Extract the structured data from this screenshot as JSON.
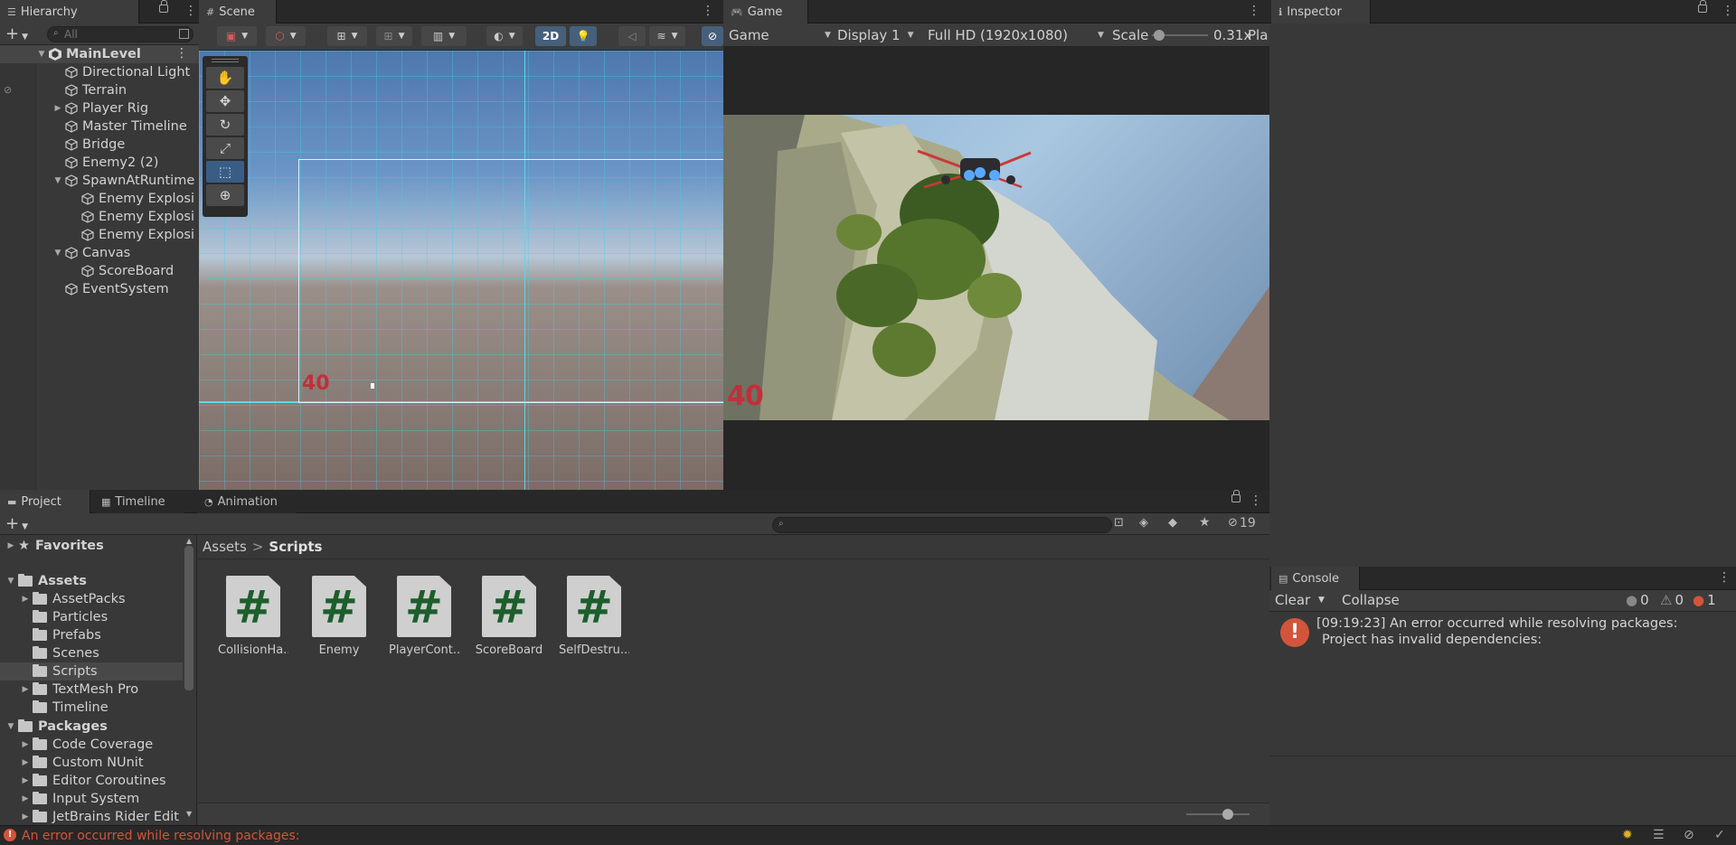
{
  "hierarchy": {
    "tab_label": "Hierarchy",
    "search_placeholder": "All",
    "scene_name": "MainLevel",
    "items": [
      {
        "label": "Directional Light"
      },
      {
        "label": "Terrain"
      },
      {
        "label": "Player Rig"
      },
      {
        "label": "Master Timeline"
      },
      {
        "label": "Bridge"
      },
      {
        "label": "Enemy2 (2)"
      },
      {
        "label": "SpawnAtRuntime"
      },
      {
        "label": "Enemy Explosi"
      },
      {
        "label": "Enemy Explosi"
      },
      {
        "label": "Enemy Explosi"
      },
      {
        "label": "Canvas"
      },
      {
        "label": "ScoreBoard"
      },
      {
        "label": "EventSystem"
      }
    ]
  },
  "scene": {
    "tab_label": "Scene",
    "toggle_2d": "2D",
    "score_text": "40"
  },
  "game": {
    "tab_label": "Game",
    "view_select": "Game",
    "display_select": "Display 1",
    "resolution_select": "Full HD (1920x1080)",
    "scale_label": "Scale",
    "scale_value": "0.31x",
    "play_cut": "Pla",
    "score_text": "40"
  },
  "inspector": {
    "tab_label": "Inspector"
  },
  "project": {
    "tabs": [
      {
        "label": "Project"
      },
      {
        "label": "Timeline"
      },
      {
        "label": "Animation"
      }
    ],
    "hidden_count": "19",
    "breadcrumb": {
      "root": "Assets",
      "sep": ">",
      "current": "Scripts"
    },
    "tree": {
      "favorites": "Favorites",
      "assets": "Assets",
      "asset_folders": [
        "AssetPacks",
        "Particles",
        "Prefabs",
        "Scenes",
        "Scripts",
        "TextMesh Pro",
        "Timeline"
      ],
      "packages": "Packages",
      "package_folders": [
        "Code Coverage",
        "Custom NUnit",
        "Editor Coroutines",
        "Input System",
        "JetBrains Rider Edit"
      ]
    },
    "files": [
      {
        "label": "CollisionHa..."
      },
      {
        "label": "Enemy"
      },
      {
        "label": "PlayerCont..."
      },
      {
        "label": "ScoreBoard"
      },
      {
        "label": "SelfDestru..."
      }
    ],
    "file_glyph": "#"
  },
  "console": {
    "tab_label": "Console",
    "clear_label": "Clear",
    "collapse_label": "Collapse",
    "count_info": "0",
    "count_warn": "0",
    "count_error": "1",
    "message_line1": "[09:19:23] An error occurred while resolving packages:",
    "message_line2": "Project has invalid dependencies:"
  },
  "status_bar": {
    "error_text": "An error occurred while resolving packages:"
  },
  "colors": {
    "accent_blue": "#3a5d86",
    "error_red": "#d2553b",
    "score_red": "#c0303a",
    "script_green": "#1c5e2c"
  }
}
